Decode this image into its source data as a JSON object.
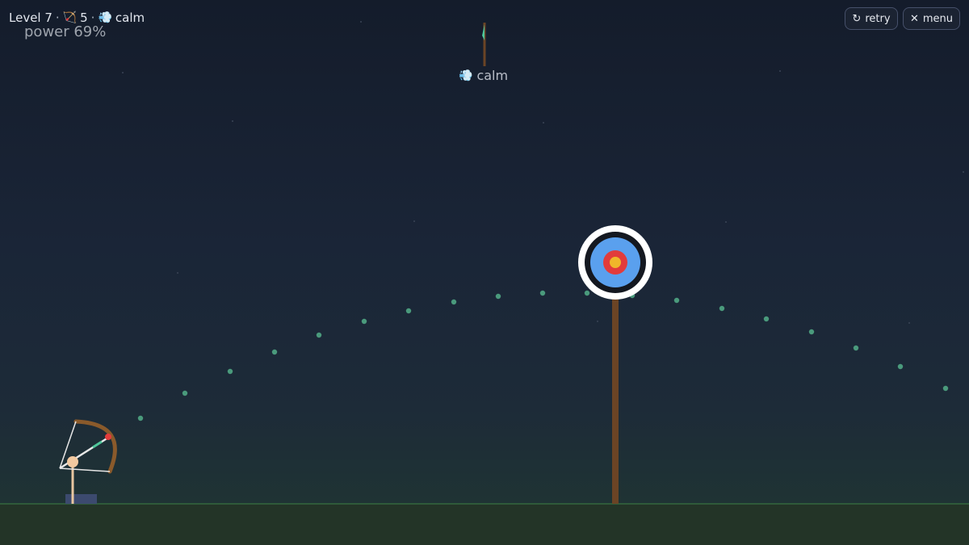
{
  "hud": {
    "level": "Level 7",
    "separator": "·",
    "arrows_icon": "bow-arrow-icon",
    "arrows_glyph": "🏹",
    "arrows_left": "5",
    "wind_icon": "wind-icon",
    "wind_glyph": "💨",
    "wind": "calm",
    "power": "power 69%",
    "power_fraction": 0.69
  },
  "buttons": {
    "retry_icon": "↻",
    "retry": "retry",
    "menu_icon": "✕",
    "menu": "menu"
  },
  "wind_indicator": {
    "label": "calm",
    "glyph": "💨"
  },
  "colors": {
    "sky_top": "#141c2b",
    "ground": "#233427",
    "ground_edge": "#2f5a3a",
    "trajectory_dot": "#4a9a7c",
    "bow_wood": "#8a5a2b",
    "target_outer": "#ffffff",
    "target_black": "#141820",
    "target_blue": "#5aa0ee",
    "target_red": "#e23b3b",
    "target_gold": "#f0b62a",
    "post": "#6b4425"
  }
}
